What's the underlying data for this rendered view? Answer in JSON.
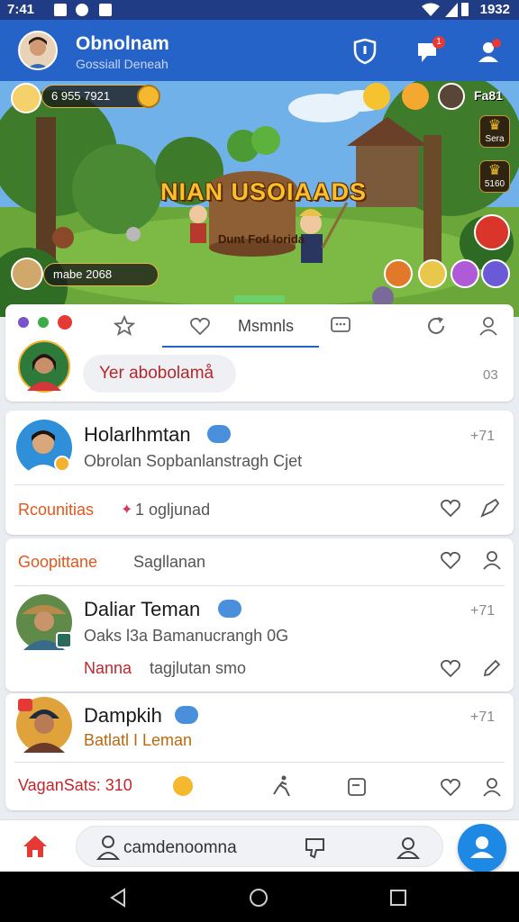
{
  "status": {
    "time": "7:41",
    "battery": "1932"
  },
  "header": {
    "title": "Obnolnam",
    "subtitle": "Gossiall Deneah",
    "notification_count": "1"
  },
  "game": {
    "top_left_value": "6 955 7921",
    "top_right_label": "Fa81",
    "title": "NIAN USOIAADS",
    "subtitle": "Dunt Fod Iorida",
    "player_status": "mabe 2068",
    "right_badges": [
      "Sera",
      "5160"
    ]
  },
  "composer": {
    "tab_label": "Msmnls",
    "input_text": "Yer abobolamå",
    "count": "03"
  },
  "posts": [
    {
      "name": "Holarlhmtan",
      "desc": "Obrolan Sopbanlanstragh Cjet",
      "stamp": "+71",
      "footer_left": "Rcounitias",
      "footer_right": "1 ogljunad"
    },
    {
      "name": "Daliar Teman",
      "desc": "Oaks l3a Bamanucrangh 0G",
      "stamp": "+71",
      "header_left": "Goopittane",
      "header_right": "Sagllanan",
      "footer_left": "Nanna",
      "footer_right": "tagjlutan smo"
    },
    {
      "name": "Dampkih",
      "desc": "Batlatl I Leman",
      "stamp": "+71",
      "footer_left": "VaganSats: 310"
    }
  ],
  "nav": {
    "pill_label": "camdenoomna"
  },
  "colors": {
    "header": "#2563c8",
    "statusbar": "#1f3c85",
    "accent": "#1e88e5",
    "orange": "#e2571d"
  }
}
